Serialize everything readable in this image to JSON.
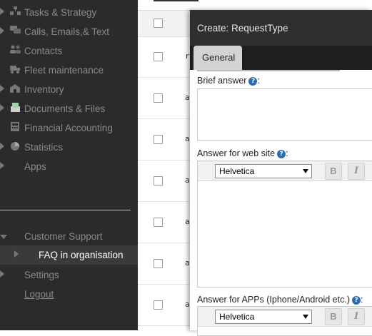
{
  "sidebar": {
    "items": [
      {
        "label": "Tasks & Strategy",
        "icon": "tasks-icon"
      },
      {
        "label": "Calls, Emails,& Text",
        "icon": "chat-icon"
      },
      {
        "label": "Contacts",
        "icon": "contacts-icon"
      },
      {
        "label": "Fleet maintenance",
        "icon": "truck-icon"
      },
      {
        "label": "Inventory",
        "icon": "inventory-icon"
      },
      {
        "label": "Documents & Files",
        "icon": "documents-icon"
      },
      {
        "label": "Financial Accounting",
        "icon": "accounting-icon"
      },
      {
        "label": "Statistics",
        "icon": "statistics-icon"
      },
      {
        "label": "Apps"
      }
    ],
    "support": {
      "label": "Customer Support"
    },
    "faq": {
      "label": "FAQ in organisation"
    },
    "settings": {
      "label": "Settings"
    },
    "logout": {
      "label": "Logout"
    }
  },
  "list": {
    "rows": [
      {
        "first_char": "r"
      },
      {
        "first_char": "a"
      },
      {
        "first_char": "a"
      },
      {
        "first_char": "a"
      },
      {
        "first_char": "a"
      },
      {
        "first_char": "a"
      },
      {
        "first_char": "a"
      }
    ]
  },
  "dialog": {
    "title": "Create: RequestType",
    "tab": "General",
    "brief_label": "Brief answer",
    "web_label": "Answer for web site",
    "apps_label": "Answer for APPs (Iphone/Android etc.)",
    "help_glyph": "?",
    "colon": ":",
    "font_value": "Helvetica",
    "bold": "B",
    "italic": "I"
  },
  "colors": {
    "sidebar_bg": "#2b2b2b",
    "title_bg": "#2f2f2f",
    "help_blue": "#2a6db5"
  }
}
